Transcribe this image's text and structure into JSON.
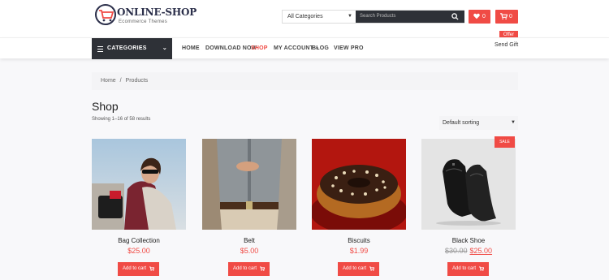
{
  "header": {
    "logo_title": "ONLINE-SHOP",
    "logo_subtitle": "Ecommerce  Themes",
    "category_select": "All Categories",
    "search_placeholder": "Search Products",
    "wishlist_count": "0",
    "cart_count": "0",
    "offer_badge": "Offer",
    "gift_text": "Send Gift"
  },
  "nav": {
    "categories_label": "CATEGORIES",
    "items": [
      {
        "label": "HOME",
        "active": false
      },
      {
        "label": "DOWNLOAD NOW",
        "active": false
      },
      {
        "label": "SHOP",
        "active": true
      },
      {
        "label": "MY ACCOUNT",
        "active": false,
        "has_dropdown": true
      },
      {
        "label": "BLOG",
        "active": false
      },
      {
        "label": "VIEW PRO",
        "active": false
      }
    ]
  },
  "breadcrumb": {
    "home": "Home",
    "separator": "/",
    "current": "Products"
  },
  "shop": {
    "title": "Shop",
    "result_count": "Showing 1–16 of 58 results",
    "sorting": "Default sorting"
  },
  "products": [
    {
      "name": "Bag Collection",
      "price": "$25.00",
      "button": "Add to cart"
    },
    {
      "name": "Belt",
      "price": "$5.00",
      "button": "Add to cart"
    },
    {
      "name": "Biscuits",
      "price": "$1.99",
      "button": "Add to cart"
    },
    {
      "name": "Black Shoe",
      "old_price": "$30.00",
      "price": "$25.00",
      "button": "Add to cart",
      "badge": "SALE"
    }
  ],
  "colors": {
    "accent": "#f04b45",
    "dark": "#2e3137"
  }
}
